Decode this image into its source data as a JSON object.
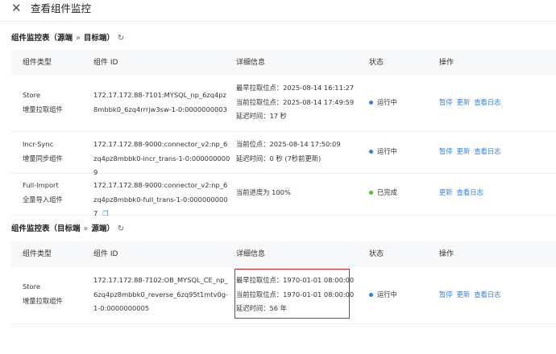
{
  "header": {
    "close_icon": "close-icon",
    "title": "查看组件监控"
  },
  "columns": [
    "组件类型",
    "组件 ID",
    "详细信息",
    "状态",
    "操作"
  ],
  "section1": {
    "title": "组件监控表（源端",
    "arrow": "»",
    "title_right": "目标端）",
    "refresh_icon": "refresh-icon",
    "rows": [
      {
        "type": "Store",
        "subtype": "增量拉取组件",
        "id": "172.17.172.88-7101:MYSQL_np_6zq4pz8mbbk0_6zq4rrrjw3sw-1-0:0000000003",
        "details": [
          "最早拉取位点：2025-08-14 16:11:27",
          "当前拉取位点：2025-08-14 17:49:59",
          "延迟时间：17 秒"
        ],
        "status": "运行中",
        "status_color": "#2f7ff0",
        "ops": [
          "暂停",
          "更新",
          "查看日志"
        ]
      },
      {
        "type": "Incr-Sync",
        "subtype": "增量同步组件",
        "id": "172.17.172.88-9000:connector_v2:np_6zq4pz8mbbk0-incr_trans-1-0:0000000009",
        "details": [
          "当前位点：2025-08-14 17:50:09",
          "延迟时间：0 秒 (7秒前更新)"
        ],
        "status": "运行中",
        "status_color": "#2f7ff0",
        "ops": [
          "暂停",
          "更新",
          "查看日志"
        ]
      },
      {
        "type": "Full-Import",
        "subtype": "全量导入组件",
        "id": "172.17.172.88-9000:connector_v2:np_6zq4pz8mbbk0-full_trans-1-0:0000000007",
        "details": [
          "当前进度为 100%"
        ],
        "status": "已完成",
        "status_color": "#52c41a",
        "ops": [
          "更新",
          "查看日志"
        ],
        "copy_icon": "copy-icon"
      }
    ]
  },
  "section2": {
    "title": "组件监控表（目标端",
    "arrow": "»",
    "title_right": "源端）",
    "refresh_icon": "refresh-icon",
    "rows": [
      {
        "type": "Store",
        "subtype": "增量拉取组件",
        "id": "172.17.172.88-7102:OB_MYSQL_CE_np_6zq4pz8mbbk0_reverse_6zq95t1mtv0g-1-0:0000000005",
        "details": [
          "最早拉取位点：1970-01-01 08:00:00",
          "当前拉取位点：1970-01-01 08:00:00",
          "延迟时间：56 年"
        ],
        "status": "运行中",
        "status_color": "#2f7ff0",
        "ops": [
          "暂停",
          "更新",
          "查看日志"
        ]
      }
    ]
  }
}
